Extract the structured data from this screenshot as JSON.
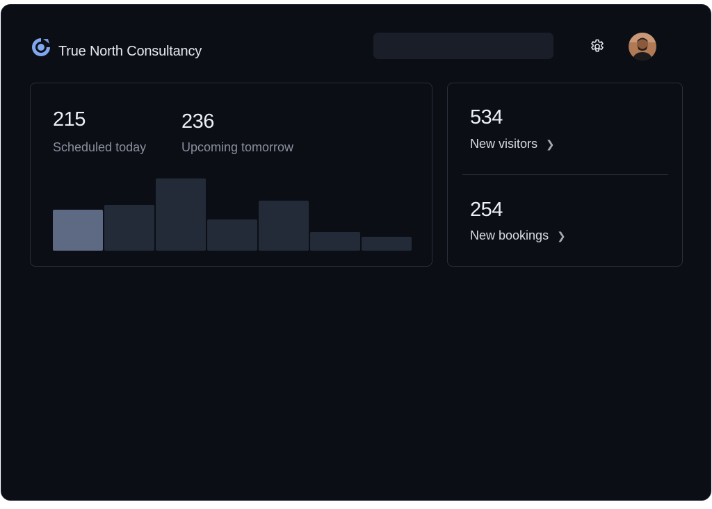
{
  "header": {
    "brand": "True North Consultancy",
    "search": {
      "placeholder": "",
      "value": ""
    }
  },
  "icons": {
    "logo": "logo-icon",
    "settings": "gear-icon",
    "avatar": "user-avatar"
  },
  "colors": {
    "background": "#0b0e15",
    "accent": "#7fa7ef",
    "bar_default": "#232a38",
    "bar_highlight": "#5e6a84"
  },
  "stats": {
    "scheduled_value": "215",
    "scheduled_label": "Scheduled today",
    "upcoming_value": "236",
    "upcoming_label": "Upcoming tomorrow"
  },
  "summary": {
    "visitors_value": "534",
    "visitors_label": "New visitors",
    "bookings_value": "254",
    "bookings_label": "New bookings"
  },
  "chart_data": {
    "type": "bar",
    "values": [
      59,
      66,
      104,
      45,
      72,
      27,
      20
    ],
    "highlight_index": 0,
    "ylim": [
      0,
      104
    ]
  }
}
